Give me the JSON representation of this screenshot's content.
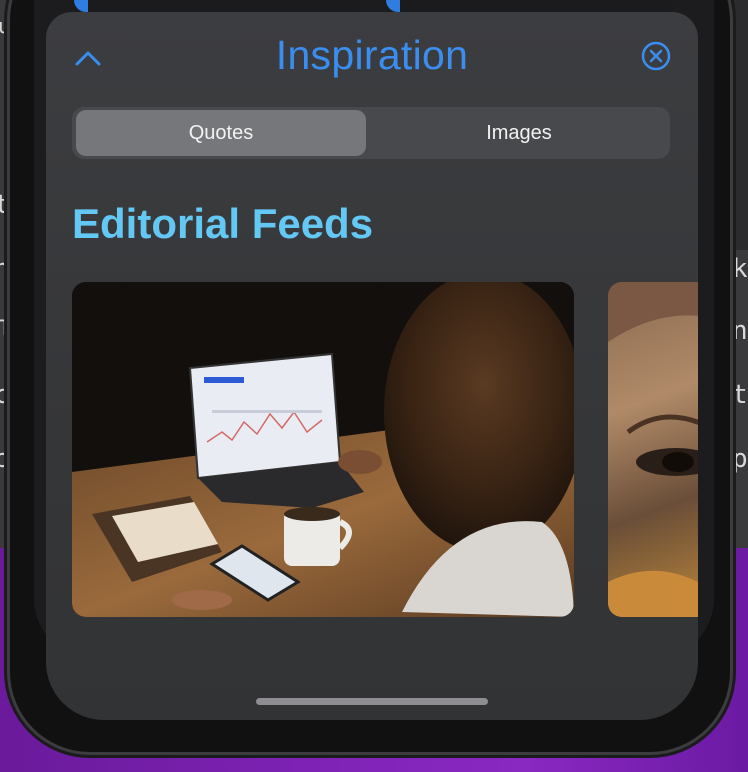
{
  "sheet": {
    "title": "Inspiration",
    "collapse_icon": "chevron-up-icon",
    "close_icon": "close-circle-icon"
  },
  "segmented_control": {
    "options": [
      "Quotes",
      "Images"
    ],
    "selected": "Quotes"
  },
  "section": {
    "title": "Editorial Feeds"
  },
  "cards": [
    {
      "name": "woman-laptop-phone-photo"
    },
    {
      "name": "woman-face-closeup-photo"
    }
  ],
  "background_edge_text": {
    "left": [
      "u",
      "t",
      "n",
      "l",
      "c",
      "p"
    ],
    "right": [
      "k",
      "n",
      "t",
      "p"
    ]
  },
  "colors": {
    "accent_blue": "#3a8ef0",
    "section_title": "#64c8f5",
    "desktop_purple": "#7d22b4"
  }
}
